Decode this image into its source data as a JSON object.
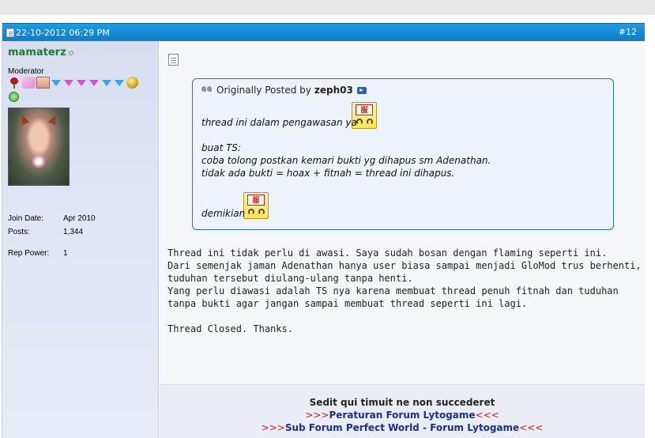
{
  "post": {
    "date": "22-10-2012 06:29 PM",
    "number": "#12"
  },
  "user": {
    "name": "mamaterz",
    "title": "Moderator",
    "stats": [
      {
        "label": "Join Date:",
        "value": "Apr 2010"
      },
      {
        "label": "Posts:",
        "value": "1,344"
      },
      {
        "label": "Rep Power:",
        "value": "1"
      }
    ],
    "rank_icons": [
      "rose-icon",
      "swan-icon",
      "face-icon",
      "blue-gem-icon",
      "purple-gem-icon",
      "purple-gem-icon",
      "purple-gem-icon",
      "blue-gem-icon",
      "blue-gem-icon",
      "gold-coin-icon"
    ]
  },
  "quote": {
    "prefix": "Originally Posted by",
    "author": "zeph03",
    "lines": [
      "thread ini dalam pengawasan ya",
      "buat TS:",
      "coba tolong postkan kemari bukti yg dihapus sm Adenathan.",
      "tidak ada bukti = hoax + fitnah = thread ini dihapus.",
      "demikian"
    ],
    "smiley_text": "服"
  },
  "message": {
    "lines": [
      "Thread ini tidak perlu di awasi. Saya sudah bosan dengan flaming seperti ini.",
      "Dari semenjak jaman Adenathan hanya user biasa sampai menjadi GloMod trus berhenti,",
      "tuduhan tersebut diulang-ulang tanpa henti.",
      "Yang perlu diawasi adalah TS nya karena membuat thread penuh fitnah dan tuduhan",
      "tanpa bukti agar jangan sampai membuat thread seperti ini lagi.",
      "",
      "Thread Closed. Thanks."
    ]
  },
  "signature": {
    "line1": "Sedit qui timuit ne non succederet",
    "arrows_left": ">>>",
    "arrows_right": "<<<",
    "link1": "Peraturan Forum Lytogame",
    "link2": "Sub Forum Perfect World - Forum Lytogame"
  },
  "colors": {
    "header": "#0b7dc8",
    "username": "#1b7d2a",
    "quote_border": "#2c6ea8",
    "link": "#1a2f8a",
    "arrow": "#d21a1a"
  }
}
